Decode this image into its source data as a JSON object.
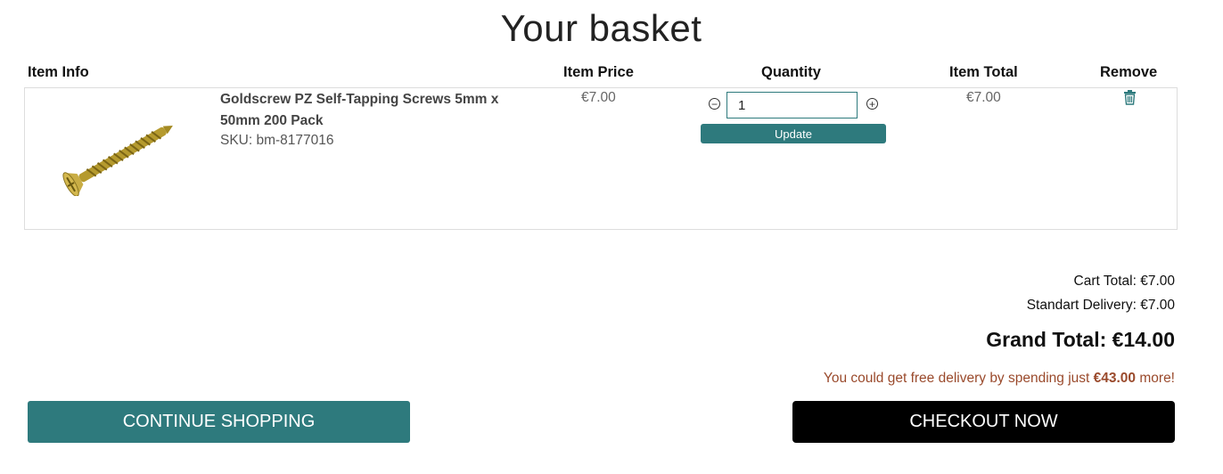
{
  "page": {
    "title": "Your basket"
  },
  "table": {
    "headers": {
      "item_info": "Item Info",
      "item_price": "Item Price",
      "quantity": "Quantity",
      "item_total": "Item Total",
      "remove": "Remove"
    }
  },
  "items": [
    {
      "name": "Goldscrew PZ Self-Tapping Screws 5mm x 50mm 200 Pack",
      "sku": "SKU: bm-8177016",
      "price": "€7.00",
      "quantity": "1",
      "total": "€7.00",
      "update_label": "Update",
      "minus_icon": "minus-circle-icon",
      "plus_icon": "plus-circle-icon",
      "remove_icon": "trash-icon"
    }
  ],
  "summary": {
    "cart_total": "Cart Total: €7.00",
    "delivery": "Standart Delivery: €7.00",
    "grand_total": "Grand Total: €14.00",
    "free_delivery_prefix": "You could get free delivery by spending just ",
    "free_delivery_amount": "€43.00",
    "free_delivery_suffix": " more!"
  },
  "buttons": {
    "continue": "CONTINUE SHOPPING",
    "checkout": "CHECKOUT NOW"
  },
  "colors": {
    "accent": "#2e7a7d",
    "notice": "#9a4a2c",
    "checkout": "#000000"
  }
}
